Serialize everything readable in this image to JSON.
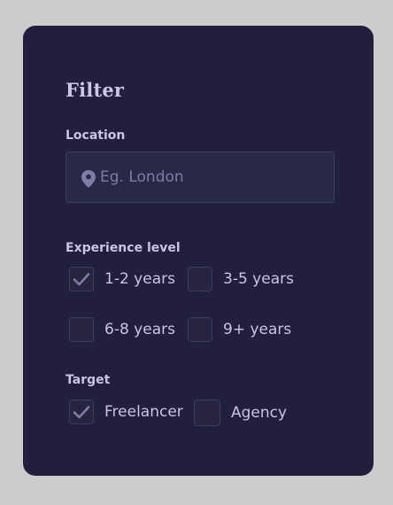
{
  "filter": {
    "title": "Filter",
    "location": {
      "label": "Location",
      "placeholder": "Eg. London",
      "value": "",
      "icon": "map-pin-icon"
    },
    "experience": {
      "label": "Experience level",
      "options": [
        {
          "label": "1-2 years",
          "checked": true
        },
        {
          "label": "3-5 years",
          "checked": false
        },
        {
          "label": "6-8 years",
          "checked": false
        },
        {
          "label": "9+ years",
          "checked": false
        }
      ]
    },
    "target": {
      "label": "Target",
      "options": [
        {
          "label": "Freelancer",
          "checked": true
        },
        {
          "label": "Agency",
          "checked": false
        }
      ]
    }
  },
  "colors": {
    "page_background": "#cccccc",
    "panel_background": "#211f3c",
    "text": "#c8c4e4",
    "muted": "#7f7ba6",
    "border": "#3d3a63"
  }
}
